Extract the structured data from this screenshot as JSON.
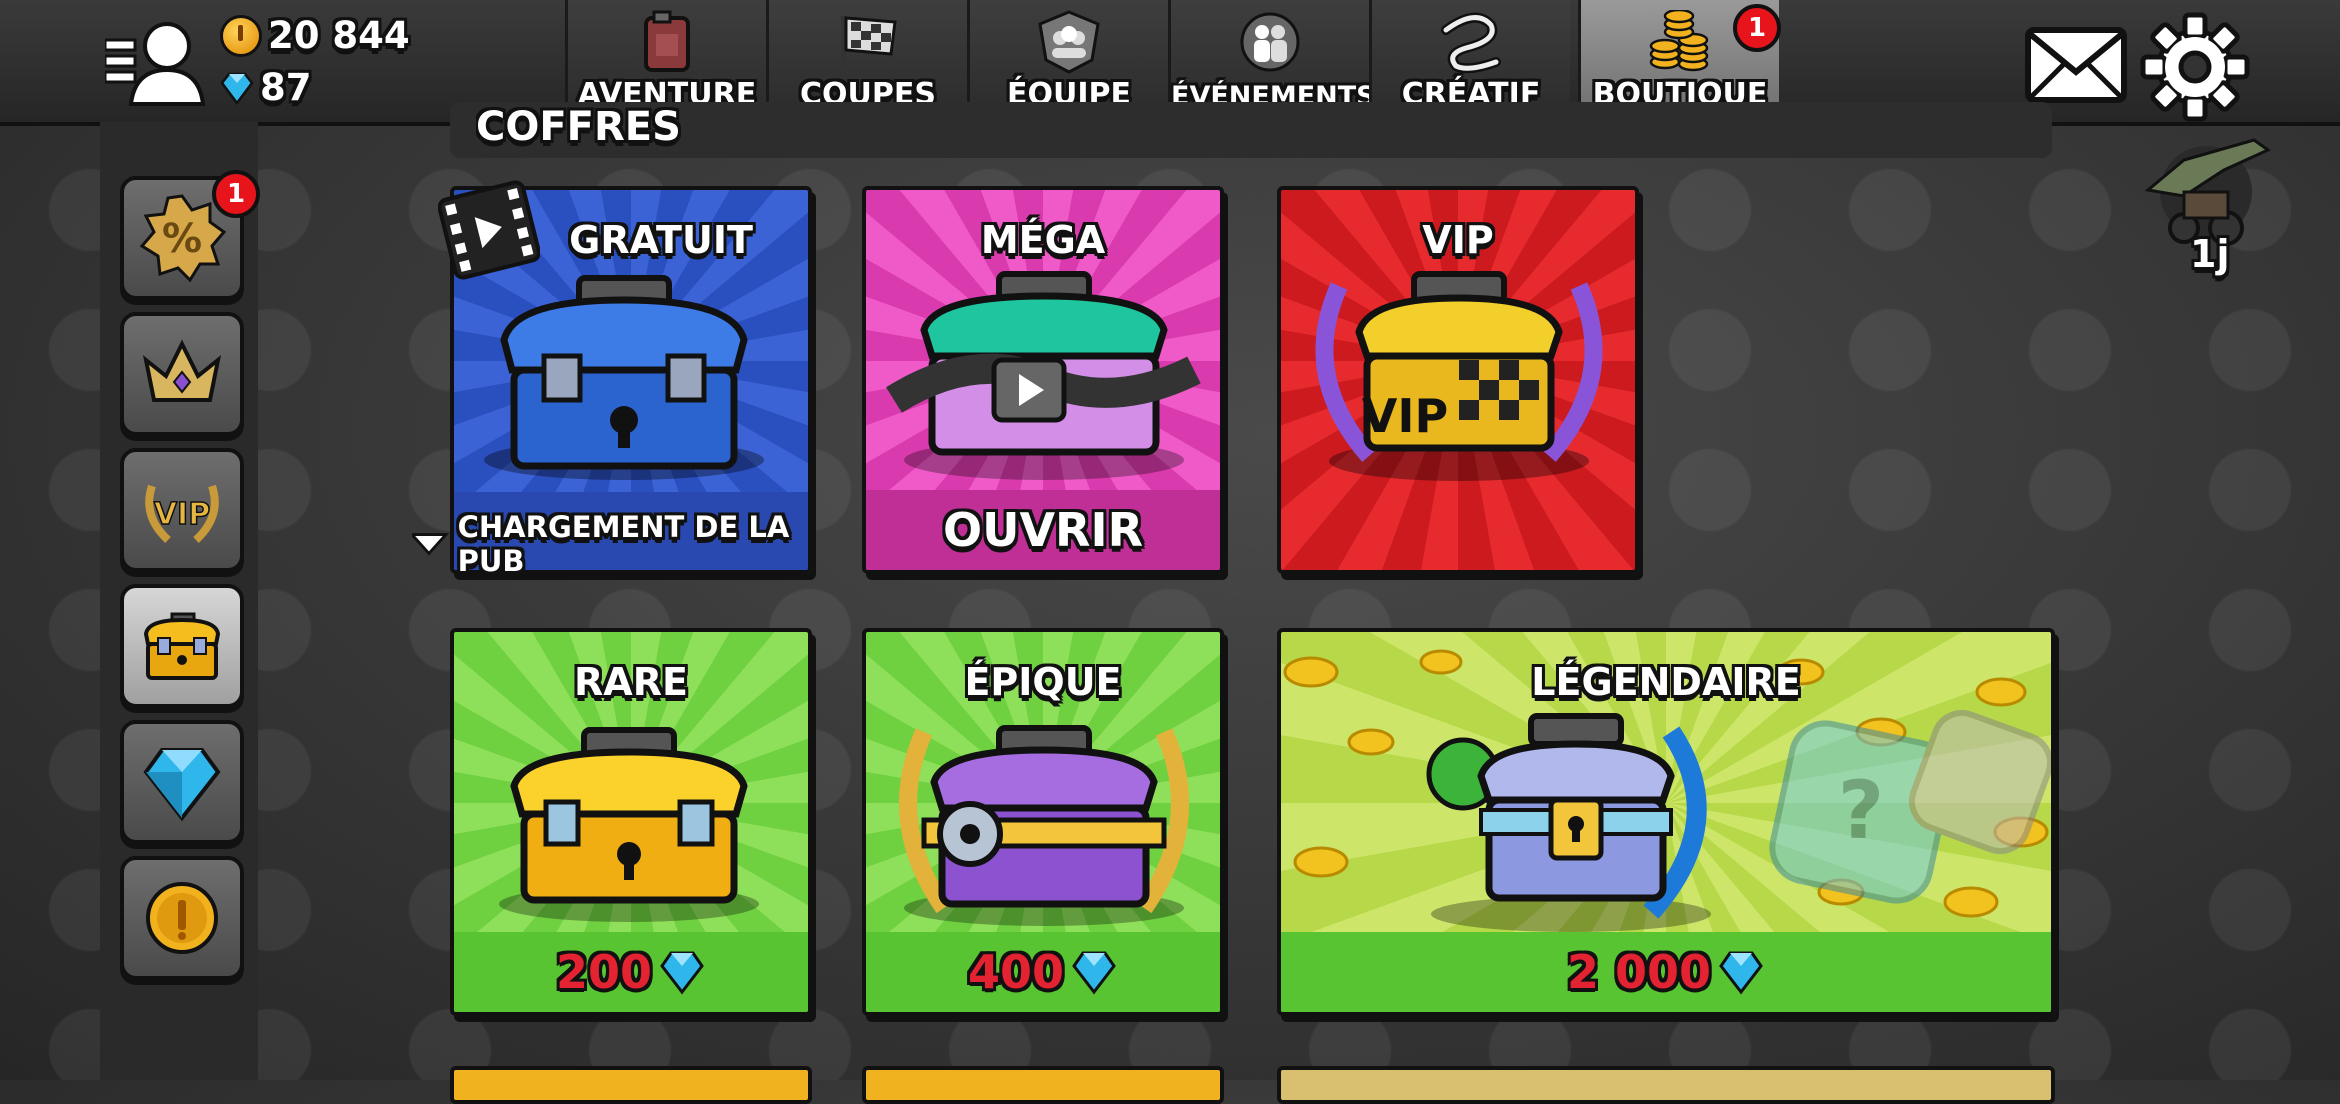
{
  "currency": {
    "coins": "20 844",
    "gems": "87"
  },
  "tabs": [
    {
      "label": "AVENTURE",
      "icon": "fuel-can-icon"
    },
    {
      "label": "COUPES",
      "icon": "checkered-flag-icon"
    },
    {
      "label": "ÉQUIPE",
      "icon": "team-badge-icon"
    },
    {
      "label": "ÉVÉNEMENTS",
      "icon": "event-people-icon"
    },
    {
      "label": "CRÉATIF",
      "icon": "creative-track-icon"
    },
    {
      "label": "BOUTIQUE",
      "icon": "coin-stacks-icon",
      "badge": "1"
    }
  ],
  "sidebar": {
    "items": [
      {
        "icon": "discount-percent-icon",
        "badge": "1"
      },
      {
        "icon": "crown-icon"
      },
      {
        "icon": "vip-laurel-icon"
      },
      {
        "icon": "chest-icon"
      },
      {
        "icon": "gem-icon"
      },
      {
        "icon": "coin-icon"
      }
    ]
  },
  "section": {
    "title": "COFFRES"
  },
  "timer": {
    "label": "1j"
  },
  "cards": {
    "free": {
      "title": "GRATUIT",
      "footer": "CHARGEMENT DE LA PUB"
    },
    "mega": {
      "title": "MÉGA",
      "footer": "OUVRIR"
    },
    "vip": {
      "title": "VIP",
      "chest_text": "VIP"
    },
    "rare": {
      "title": "RARE",
      "price": "200"
    },
    "epic": {
      "title": "ÉPIQUE",
      "price": "400"
    },
    "legendary": {
      "title": "LÉGENDAIRE",
      "price": "2 000"
    }
  },
  "colors": {
    "blue_card": "#2f55c8",
    "pink_card": "#e040b8",
    "red_card": "#d41e22",
    "green_card": "#5ccc2e",
    "price_red": "#e32232",
    "badge_red": "#e8141c"
  }
}
